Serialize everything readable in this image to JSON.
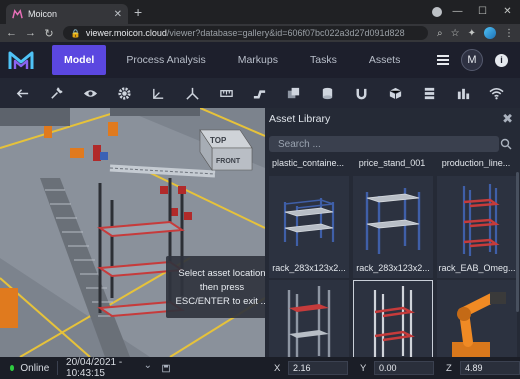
{
  "browser": {
    "tab_title": "Moicon",
    "tab_close": "✕",
    "new_tab": "+",
    "url_host": "viewer.moicon.cloud",
    "url_path": "/viewer?database=gallery&id=606f07bc022a3d27d091d828"
  },
  "app": {
    "nav": [
      "Model",
      "Process Analysis",
      "Markups",
      "Tasks",
      "Assets"
    ],
    "active_nav": "Model",
    "avatar_initial": "M",
    "info": "i"
  },
  "toolbar": {
    "tools": [
      "back-arrow",
      "wrench",
      "eye",
      "gear",
      "axes",
      "tripod",
      "measure",
      "pipe",
      "cube",
      "cylinder",
      "magnet",
      "box",
      "layers",
      "bar-chart",
      "wifi"
    ]
  },
  "viewport": {
    "cube_top": "TOP",
    "cube_front": "FRONT",
    "tooltip": [
      "Select asset location",
      "then press",
      "ESC/ENTER to exit ..."
    ]
  },
  "library": {
    "title": "Asset Library",
    "close": "✖",
    "search_placeholder": "Search ...",
    "top_labels": [
      "plastic_containe...",
      "price_stand_001",
      "production_line..."
    ],
    "cards": [
      {
        "label": "rack_283x123x2...",
        "kind": "rack-blue"
      },
      {
        "label": "rack_283x123x2...",
        "kind": "rack-blue-tall"
      },
      {
        "label": "rack_EAB_Omeg...",
        "kind": "rack-red"
      },
      {
        "label": "",
        "kind": "rack-gray-red"
      },
      {
        "label": "",
        "kind": "rack-white-red"
      },
      {
        "label": "",
        "kind": "robot-arm"
      }
    ]
  },
  "status": {
    "online": "Online",
    "datetime": "20/04/2021 - 10:43:15",
    "chevron": "⌄",
    "x_label": "X",
    "x_value": "2.16",
    "y_label": "Y",
    "y_value": "0.00",
    "z_label": "Z",
    "z_value": "4.89"
  },
  "colors": {
    "accent": "#5b47e0",
    "online": "#2ecc40",
    "header_bg": "#1d1f2c"
  }
}
